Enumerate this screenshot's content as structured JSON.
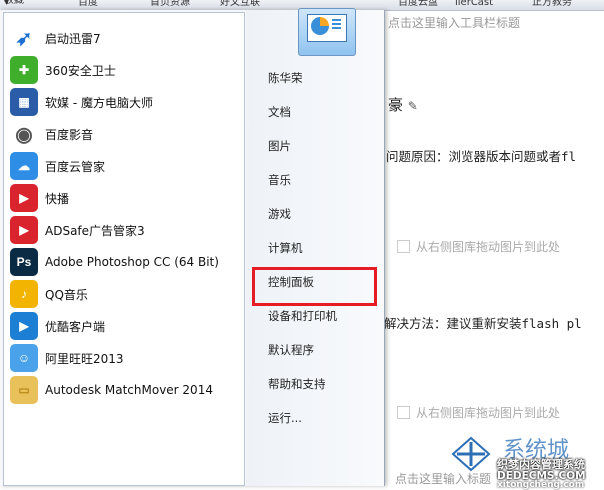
{
  "bookmarks": [
    {
      "label": "收藏",
      "x_note": "menu"
    },
    {
      "label": "百度"
    },
    {
      "label": "首页资源"
    },
    {
      "label": "好文互联"
    },
    {
      "label": "百度云盘"
    },
    {
      "label": "lierCast"
    },
    {
      "label": "正方教务"
    }
  ],
  "background_page": {
    "top_hint": "点击这里输入工具栏标题",
    "title_fragment": "豪",
    "problem": "问题原因：浏览器版本问题或者fl",
    "image_hint_1": "从右侧图库拖动图片到此处",
    "solution": "解决方法：建议重新安装flash pl",
    "image_hint_2": "从右侧图库拖动图片到此处",
    "bottom_hint": "点击这里输入标题"
  },
  "start_menu": {
    "programs": [
      {
        "label": "启动迅雷7",
        "icon": "thunder-icon",
        "color": "#1a6fd1"
      },
      {
        "label": "360安全卫士",
        "icon": "360-safe-icon",
        "color": "#3fae2a"
      },
      {
        "label": "软媒 - 魔方电脑大师",
        "icon": "rubik-cube-icon",
        "color": "#2a5ca8"
      },
      {
        "label": "百度影音",
        "icon": "film-reel-icon",
        "color": "#555555"
      },
      {
        "label": "百度云管家",
        "icon": "baidu-cloud-icon",
        "color": "#2e8ee6"
      },
      {
        "label": "快播",
        "icon": "qvod-icon",
        "color": "#d9232d"
      },
      {
        "label": "ADSafe广告管家3",
        "icon": "adsafe-icon",
        "color": "#d9232d"
      },
      {
        "label": "Adobe Photoshop CC (64 Bit)",
        "icon": "photoshop-icon",
        "color": "#0b2b44"
      },
      {
        "label": "QQ音乐",
        "icon": "qq-music-icon",
        "color": "#f2b400"
      },
      {
        "label": "优酷客户端",
        "icon": "youku-icon",
        "color": "#1d7fd3"
      },
      {
        "label": "阿里旺旺2013",
        "icon": "aliwangwang-icon",
        "color": "#4aa3ea"
      },
      {
        "label": "Autodesk MatchMover 2014",
        "icon": "folder-icon",
        "color": "#e9c15a"
      }
    ],
    "places": [
      {
        "label": "陈华荣"
      },
      {
        "label": "文档"
      },
      {
        "label": "图片"
      },
      {
        "label": "音乐"
      },
      {
        "label": "游戏"
      },
      {
        "label": "计算机"
      },
      {
        "label": "控制面板"
      },
      {
        "label": "设备和打印机"
      },
      {
        "label": "默认程序"
      },
      {
        "label": "帮助和支持"
      },
      {
        "label": "运行..."
      }
    ],
    "highlight_color": "#e51c23"
  },
  "watermark": {
    "brand": "系统城",
    "line1": "织梦内容管理系统",
    "line2": "DEDECMS.COM",
    "line3": "xitongcheng.com"
  }
}
